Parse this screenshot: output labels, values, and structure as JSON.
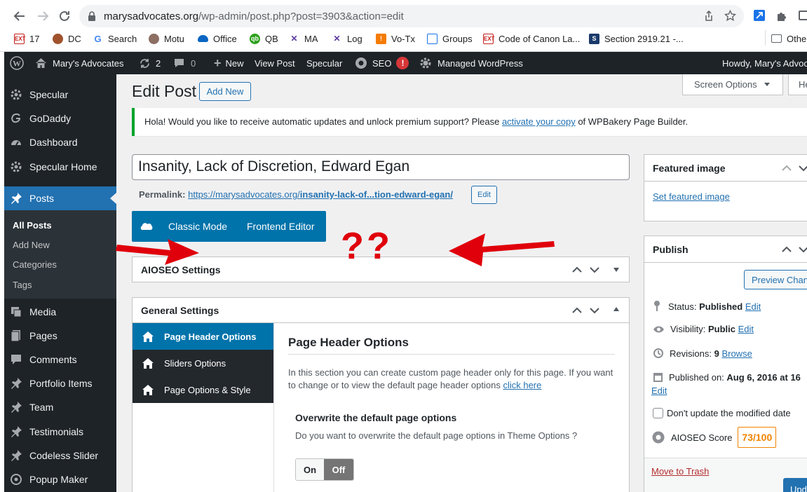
{
  "browser": {
    "url_host": "marysadvocates.org",
    "url_path": "/wp-admin/post.php?post=3903&action=edit",
    "bookmarks": [
      {
        "label": "17",
        "icon": "calendar-icon",
        "color": "#c5221f"
      },
      {
        "label": "DC",
        "icon": "dc-icon",
        "color": "#a0522d"
      },
      {
        "label": "Search",
        "icon": "google-icon",
        "color": "#4285f4"
      },
      {
        "label": "Motu",
        "icon": "motu-icon",
        "color": "#8d6e63"
      },
      {
        "label": "Office",
        "icon": "cloud-icon",
        "color": "#0a66c2"
      },
      {
        "label": "QB",
        "icon": "qb-icon",
        "color": "#2ca01c"
      },
      {
        "label": "MA",
        "icon": "ma-icon",
        "color": "#5b3a9e"
      },
      {
        "label": "Log",
        "icon": "log-icon",
        "color": "#5b3a9e"
      },
      {
        "label": "Vo-Tx",
        "icon": "votx-icon",
        "color": "#f57c00"
      },
      {
        "label": "Groups",
        "icon": "mail-icon",
        "color": "#1a73e8"
      },
      {
        "label": "Code of Canon La...",
        "icon": "canon-icon",
        "color": "#c5221f"
      },
      {
        "label": "Section 2919.21 -...",
        "icon": "section-icon",
        "color": "#1a3a6b"
      },
      {
        "label": "Othe",
        "icon": "folder-icon",
        "color": "#5f6368"
      }
    ]
  },
  "adminbar": {
    "site": "Mary's Advocates",
    "updates": "2",
    "comments": "0",
    "new": "New",
    "view_post": "View Post",
    "specular": "Specular",
    "seo": "SEO",
    "seo_badge": "!",
    "managed": "Managed WordPress",
    "howdy": "Howdy, Mary's Advoc"
  },
  "sidebar": {
    "items_top": [
      "Specular",
      "GoDaddy",
      "Dashboard",
      "Specular Home"
    ],
    "posts": "Posts",
    "posts_sub": [
      "All Posts",
      "Add New",
      "Categories",
      "Tags"
    ],
    "items_bottom": [
      "Media",
      "Pages",
      "Comments",
      "Portfolio Items",
      "Team",
      "Testimonials",
      "Codeless Slider",
      "Popup Maker"
    ]
  },
  "page": {
    "title": "Edit Post",
    "add_new": "Add New",
    "screen_options": "Screen Options",
    "help": "He",
    "notice_text": "Hola! Would you like to receive automatic updates and unlock premium support? Please ",
    "notice_link": "activate your copy",
    "notice_end": " of WPBakery Page Builder.",
    "post_title": "Insanity, Lack of Discretion, Edward Egan",
    "permalink_label": "Permalink:",
    "permalink_base": "https://marysadvocates.org/",
    "permalink_slug": "insanity-lack-of...tion-edward-egan/",
    "permalink_edit": "Edit",
    "classic_mode": "Classic Mode",
    "frontend_editor": "Frontend Editor",
    "annotation": "??",
    "aioseo_title": "AIOSEO Settings",
    "general_title": "General Settings",
    "tabs": [
      "Page Header Options",
      "Sliders Options",
      "Page Options & Style"
    ],
    "panel_title": "Page Header Options",
    "panel_desc": "In this section you can create custom page header only for this page. If you want to change or to view the default page header options ",
    "panel_link": "click here",
    "overwrite_title": "Overwrite the default page options",
    "overwrite_desc": "Do you want to overwrite the default page options in Theme Options ?",
    "toggle_on": "On",
    "toggle_off": "Off"
  },
  "featured": {
    "title": "Featured image",
    "link": "Set featured image"
  },
  "publish": {
    "title": "Publish",
    "preview": "Preview Chan",
    "status_label": "Status:",
    "status_value": "Published",
    "visibility_label": "Visibility:",
    "visibility_value": "Public",
    "revisions_label": "Revisions:",
    "revisions_value": "9",
    "browse": "Browse",
    "published_label": "Published on:",
    "published_value": "Aug 6, 2016 at 16",
    "edit": "Edit",
    "dont_update": "Don't update the modified date",
    "aioseo_label": "AIOSEO Score",
    "aioseo_score": "73/100",
    "trash": "Move to Trash",
    "update": "Upd"
  },
  "colors": {
    "accent": "#2271b1",
    "wpbakery": "#0073aa",
    "annotation": "#e0000b",
    "score": "#f18200"
  }
}
